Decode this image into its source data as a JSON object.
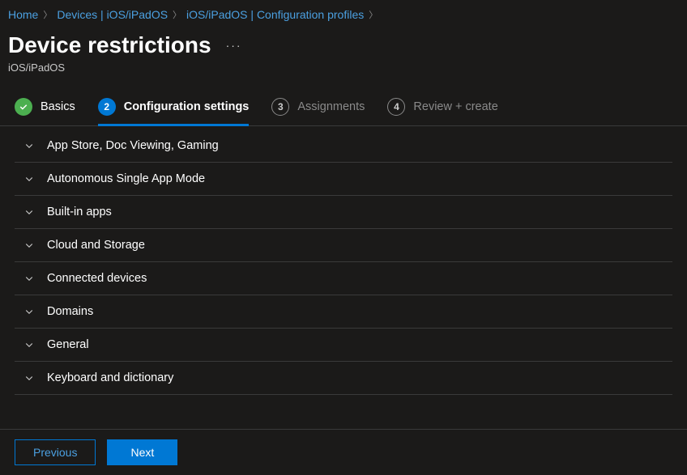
{
  "breadcrumb": {
    "items": [
      {
        "label": "Home"
      },
      {
        "label": "Devices | iOS/iPadOS"
      },
      {
        "label": "iOS/iPadOS | Configuration profiles"
      }
    ]
  },
  "page": {
    "title": "Device restrictions",
    "subtitle": "iOS/iPadOS"
  },
  "tabs": [
    {
      "label": "Basics",
      "state": "done"
    },
    {
      "label": "Configuration settings",
      "state": "active",
      "number": "2"
    },
    {
      "label": "Assignments",
      "state": "pending",
      "number": "3"
    },
    {
      "label": "Review + create",
      "state": "pending",
      "number": "4"
    }
  ],
  "sections": [
    {
      "label": "App Store, Doc Viewing, Gaming"
    },
    {
      "label": "Autonomous Single App Mode"
    },
    {
      "label": "Built-in apps"
    },
    {
      "label": "Cloud and Storage"
    },
    {
      "label": "Connected devices"
    },
    {
      "label": "Domains"
    },
    {
      "label": "General"
    },
    {
      "label": "Keyboard and dictionary"
    }
  ],
  "footer": {
    "previous": "Previous",
    "next": "Next"
  }
}
